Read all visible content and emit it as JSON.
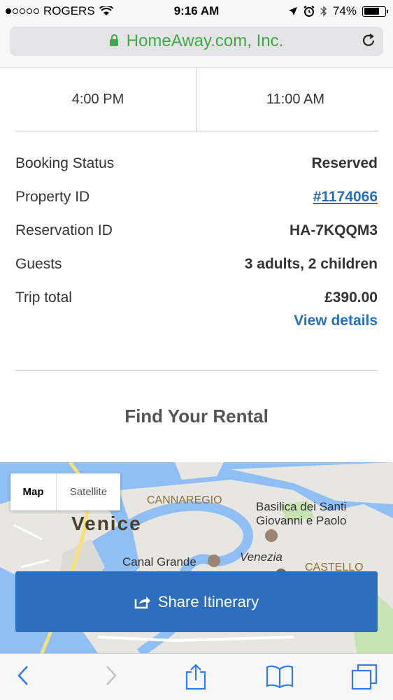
{
  "status_bar": {
    "carrier": "ROGERS",
    "time": "9:16 AM",
    "battery": "74%",
    "battery_level": 0.74
  },
  "url_bar": {
    "site": "HomeAway.com, Inc."
  },
  "times": {
    "check_in": "4:00 PM",
    "check_out": "11:00 AM"
  },
  "details": [
    {
      "label": "Booking Status",
      "value": "Reserved"
    },
    {
      "label": "Property ID",
      "value": "#1174066"
    },
    {
      "label": "Reservation ID",
      "value": "HA-7KQQM3"
    },
    {
      "label": "Guests",
      "value": "3 adults, 2 children"
    },
    {
      "label": "Trip total",
      "value": "£390.00"
    }
  ],
  "view_details": "View details",
  "find_rental": {
    "title": "Find Your Rental"
  },
  "map": {
    "map_tab": "Map",
    "satellite_tab": "Satellite",
    "labels": {
      "venice": "Venice",
      "cannaregio": "CANNAREGIO",
      "basilica_line1": "Basilica dei Santi",
      "basilica_line2": "Giovanni e Paolo",
      "canal_grande": "Canal Grande",
      "venezia": "Venezia",
      "castello": "CASTELLO"
    }
  },
  "share_button": {
    "label": "Share Itinerary"
  },
  "colors": {
    "link_blue": "#2a6ebb",
    "button_blue": "#2d6ebf",
    "secure_green": "#3fa848",
    "ios_blue": "#3478f6"
  },
  "toolbar": {
    "icons": [
      "back-icon",
      "forward-icon",
      "share-icon",
      "bookmarks-icon",
      "tabs-icon"
    ]
  }
}
